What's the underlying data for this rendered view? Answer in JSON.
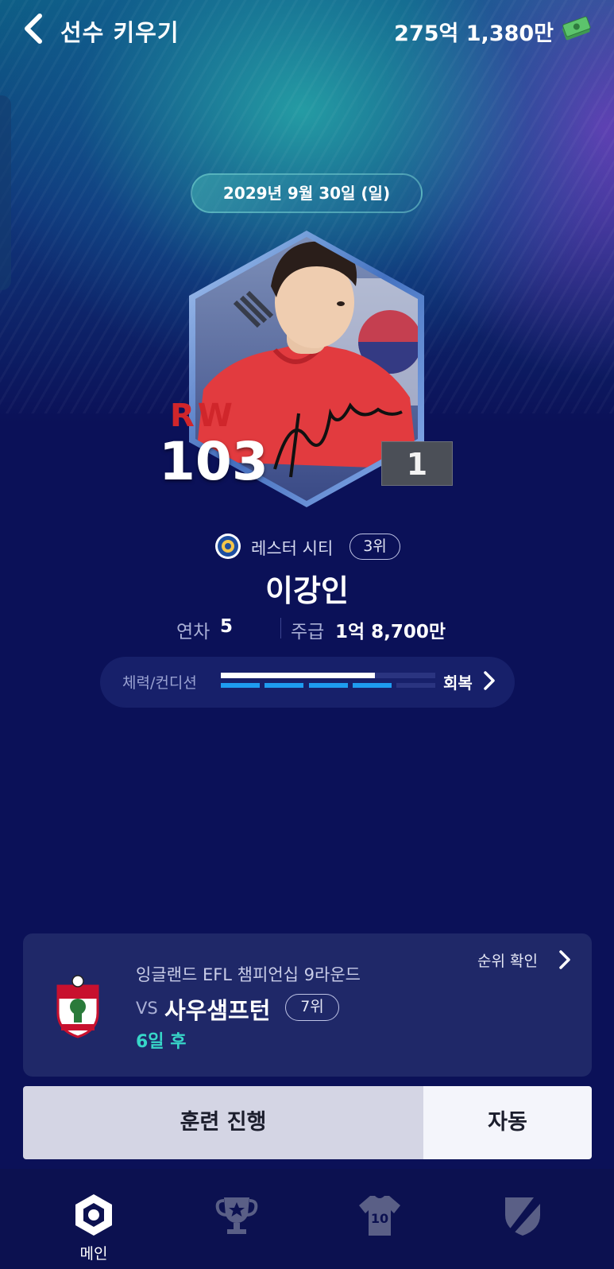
{
  "header": {
    "title": "선수 키우기",
    "balance": "275억 1,380만",
    "back_icon": "chevron-left-icon",
    "money_icon": "money-stack-icon"
  },
  "date": "2029년 9월 30일 (일)",
  "card": {
    "position": "RW",
    "overall": "103",
    "level": "1",
    "position_color": "#d0262b"
  },
  "club": {
    "name": "레스터 시티",
    "rank": "3위"
  },
  "player": {
    "name": "이강인"
  },
  "info": {
    "year_label": "연차",
    "year_value": "5",
    "wage_label": "주급",
    "wage_value": "1억 8,700만"
  },
  "stamina": {
    "label": "체력/컨디션",
    "stamina_fraction": 0.72,
    "condition_segments_on": 4,
    "condition_segments_total": 5,
    "recover_label": "회복"
  },
  "match": {
    "round": "잉글랜드 EFL 챔피언십 9라운드",
    "vs": "VS",
    "opponent": "사우샘프턴",
    "opponent_rank": "7위",
    "days_left": "6일 후",
    "ranking_link": "순위 확인"
  },
  "actions": {
    "train": "훈련 진행",
    "auto": "자동"
  },
  "nav": {
    "items": [
      {
        "label": "메인",
        "icon": "main-hexagon-icon"
      },
      {
        "label": "",
        "icon": "trophy-icon"
      },
      {
        "label": "",
        "icon": "jersey-icon"
      },
      {
        "label": "",
        "icon": "shield-icon"
      }
    ],
    "jersey_number": "10"
  },
  "colors": {
    "background": "#0b1158",
    "accent_teal": "#37d6c8",
    "accent_blue": "#1e9cf0"
  }
}
